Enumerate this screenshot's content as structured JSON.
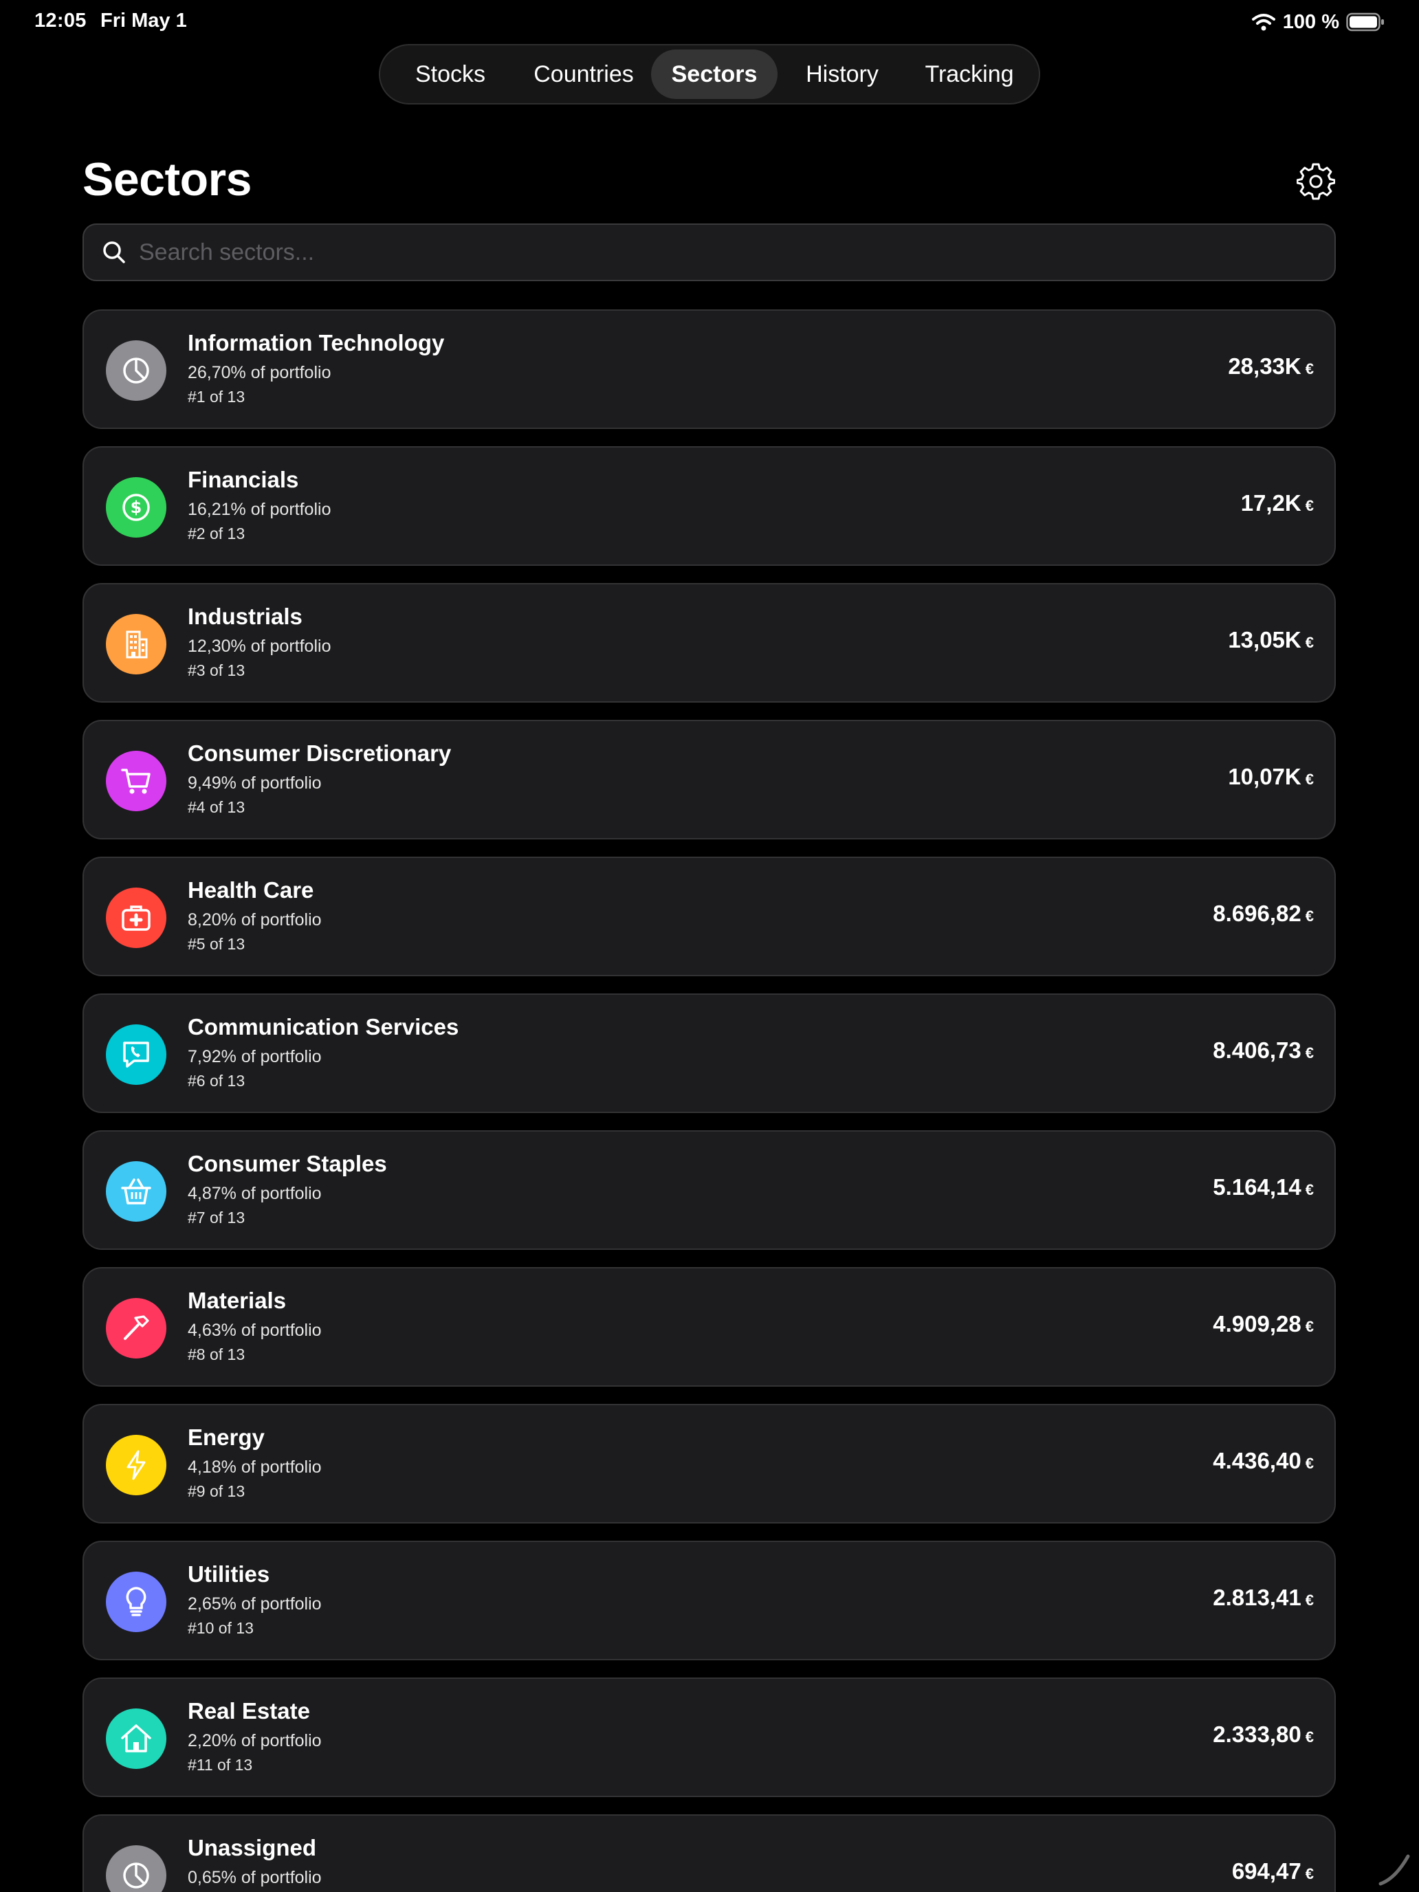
{
  "status_bar": {
    "time": "12:05",
    "date": "Fri May 1",
    "battery": "100 %"
  },
  "nav": {
    "tabs": [
      {
        "label": "Stocks"
      },
      {
        "label": "Countries"
      },
      {
        "label": "Sectors"
      },
      {
        "label": "History"
      },
      {
        "label": "Tracking"
      }
    ],
    "active_tab": "Sectors"
  },
  "header": {
    "title": "Sectors"
  },
  "search": {
    "placeholder": "Search sectors...",
    "value": ""
  },
  "currency_symbol": "€",
  "sectors": [
    {
      "name": "Information Technology",
      "percent": "26,70% of portfolio",
      "rank": "#1 of 13",
      "value": "28,33K",
      "icon": "pie-chart-icon",
      "color": "#8e8e93"
    },
    {
      "name": "Financials",
      "percent": "16,21% of portfolio",
      "rank": "#2 of 13",
      "value": "17,2K",
      "icon": "dollar-icon",
      "color": "#30d158"
    },
    {
      "name": "Industrials",
      "percent": "12,30% of portfolio",
      "rank": "#3 of 13",
      "value": "13,05K",
      "icon": "building-icon",
      "color": "#ff9f40"
    },
    {
      "name": "Consumer Discretionary",
      "percent": "9,49% of portfolio",
      "rank": "#4 of 13",
      "value": "10,07K",
      "icon": "cart-icon",
      "color": "#d83cf0"
    },
    {
      "name": "Health Care",
      "percent": "8,20% of portfolio",
      "rank": "#5 of 13",
      "value": "8.696,82",
      "icon": "medical-bag-icon",
      "color": "#ff453a"
    },
    {
      "name": "Communication Services",
      "percent": "7,92% of portfolio",
      "rank": "#6 of 13",
      "value": "8.406,73",
      "icon": "phone-bubble-icon",
      "color": "#00c7d4"
    },
    {
      "name": "Consumer Staples",
      "percent": "4,87% of portfolio",
      "rank": "#7 of 13",
      "value": "5.164,14",
      "icon": "basket-icon",
      "color": "#40c8f4"
    },
    {
      "name": "Materials",
      "percent": "4,63% of portfolio",
      "rank": "#8 of 13",
      "value": "4.909,28",
      "icon": "hammer-icon",
      "color": "#ff375f"
    },
    {
      "name": "Energy",
      "percent": "4,18% of portfolio",
      "rank": "#9 of 13",
      "value": "4.436,40",
      "icon": "bolt-icon",
      "color": "#ffd60a"
    },
    {
      "name": "Utilities",
      "percent": "2,65% of portfolio",
      "rank": "#10 of 13",
      "value": "2.813,41",
      "icon": "lightbulb-icon",
      "color": "#6e7bff"
    },
    {
      "name": "Real Estate",
      "percent": "2,20% of portfolio",
      "rank": "#11 of 13",
      "value": "2.333,80",
      "icon": "house-icon",
      "color": "#1ed8b8"
    },
    {
      "name": "Unassigned",
      "percent": "0,65% of portfolio",
      "rank": "",
      "value": "694,47",
      "icon": "pie-chart-icon",
      "color": "#8e8e93"
    }
  ]
}
